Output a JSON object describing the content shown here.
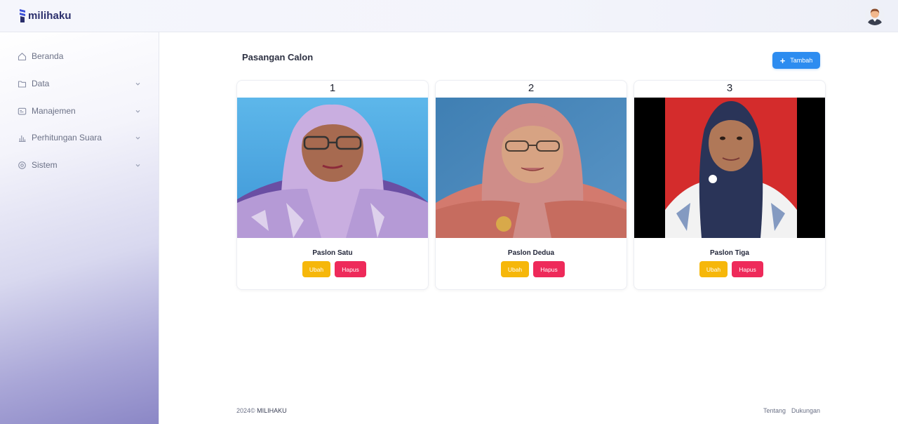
{
  "app": {
    "brand": "milihaku"
  },
  "sidebar": {
    "items": [
      {
        "label": "Beranda",
        "icon": "home-icon",
        "expandable": false
      },
      {
        "label": "Data",
        "icon": "folder-icon",
        "expandable": true
      },
      {
        "label": "Manajemen",
        "icon": "id-card-icon",
        "expandable": true
      },
      {
        "label": "Perhitungan Suara",
        "icon": "bar-chart-icon",
        "expandable": true
      },
      {
        "label": "Sistem",
        "icon": "gear-icon",
        "expandable": true
      }
    ]
  },
  "main": {
    "title": "Pasangan Calon",
    "add_button": "Tambah",
    "cards": [
      {
        "number": "1",
        "name": "Paslon Satu",
        "edit": "Ubah",
        "delete": "Hapus"
      },
      {
        "number": "2",
        "name": "Paslon Dedua",
        "edit": "Ubah",
        "delete": "Hapus"
      },
      {
        "number": "3",
        "name": "Paslon Tiga",
        "edit": "Ubah",
        "delete": "Hapus"
      }
    ]
  },
  "footer": {
    "year": "2024©",
    "name": "MILIHAKU",
    "links": [
      "Tentang",
      "Dukungan"
    ]
  },
  "colors": {
    "primary": "#2d8cf0",
    "edit": "#f6b70a",
    "delete": "#ee2a5a",
    "brand": "#2a2e6b"
  }
}
